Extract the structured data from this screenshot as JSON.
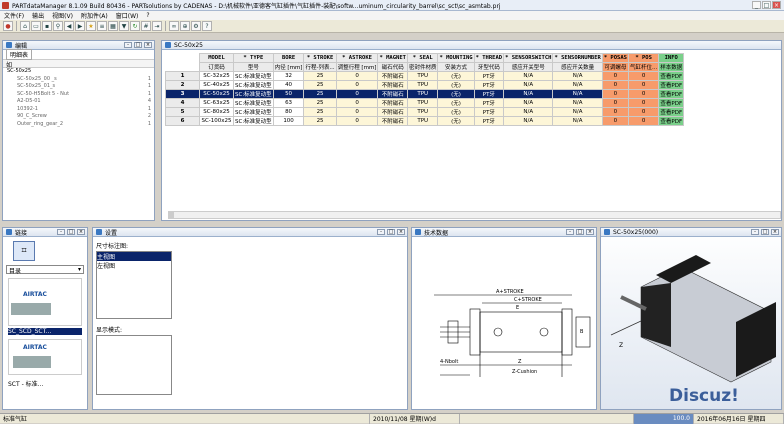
{
  "window": {
    "title": "PARTdataManager 8.1.09 Build 80436 - PARTsolutions by CADENAS - D:\\机械软件\\亚德客气缸插件\\气缸插件-装配\\softw...uminum_circularity_barrel\\sc_sct\\sc_asmtab.prj"
  },
  "menu": [
    "文件(F)",
    "输出",
    "视图(V)",
    "附加件(A)",
    "窗口(W)",
    "?"
  ],
  "left_panel": {
    "title": "编辑",
    "tab": "明细表",
    "filter_label": "如",
    "tree": [
      {
        "label": "SC-50x25",
        "count": ""
      },
      {
        "label": "SC-50x25_00 _s",
        "count": "1"
      },
      {
        "label": "SC-50x25_01_s",
        "count": "1"
      },
      {
        "label": "SC-50-H5Bolt 5 - Nut",
        "count": "1"
      },
      {
        "label": "A2-D5-01",
        "count": "4"
      },
      {
        "label": "10392-1",
        "count": "1"
      },
      {
        "label": "90_C_Screw",
        "count": "2"
      },
      {
        "label": "Outer_ring_gear_2",
        "count": "1"
      }
    ]
  },
  "table_panel": {
    "title": "SC-50x25",
    "headers": [
      {
        "key": "MODEL",
        "sub": "订货码",
        "color": "#ebebeb"
      },
      {
        "key": "* TYPE",
        "sub": "型号",
        "color": "#ebebeb"
      },
      {
        "key": "BORE",
        "sub": "内径 [mm]",
        "color": "#ebebeb"
      },
      {
        "key": "* STROKE",
        "sub": "行程-列表...",
        "color": "#ebebeb"
      },
      {
        "key": "* ASTROKE",
        "sub": "调整行程 [mm]",
        "color": "#ebebeb"
      },
      {
        "key": "* MAGNET",
        "sub": "磁石代码",
        "color": "#ebebeb"
      },
      {
        "key": "* SEAL",
        "sub": "密封件材质",
        "color": "#ebebeb"
      },
      {
        "key": "* MOUNTING",
        "sub": "安装方式",
        "color": "#ebebeb"
      },
      {
        "key": "* THREAD",
        "sub": "牙型代码",
        "color": "#ebebeb"
      },
      {
        "key": "* SENSORSWITCH",
        "sub": "感应开关型号",
        "color": "#ebebeb"
      },
      {
        "key": "* SENSORNUMBER",
        "sub": "感应开关数量",
        "color": "#ebebeb"
      },
      {
        "key": "* POSAS",
        "sub": "可调螺母",
        "color": "#f79b6b"
      },
      {
        "key": "* POS",
        "sub": "气缸杆位...",
        "color": "#f79b6b"
      },
      {
        "key": "INFO",
        "sub": "样本数据",
        "color": "#7ad08a"
      }
    ],
    "rows": [
      {
        "n": "1",
        "cells": [
          "SC-32x25",
          "SC:标准复动型",
          "32",
          "25",
          "0",
          "不附磁石",
          "TPU",
          "(无)",
          "PT牙",
          "N/A",
          "N/A",
          "0",
          "0",
          "查看PDF"
        ]
      },
      {
        "n": "2",
        "cells": [
          "SC-40x25",
          "SC:标准复动型",
          "40",
          "25",
          "0",
          "不附磁石",
          "TPU",
          "(无)",
          "PT牙",
          "N/A",
          "N/A",
          "0",
          "0",
          "查看PDF"
        ]
      },
      {
        "n": "3",
        "cells": [
          "SC-50x25",
          "SC:标准复动型",
          "50",
          "25",
          "0",
          "不附磁石",
          "TPU",
          "(无)",
          "PT牙",
          "N/A",
          "N/A",
          "0",
          "0",
          "查看PDF"
        ]
      },
      {
        "n": "4",
        "cells": [
          "SC-63x25",
          "SC:标准复动型",
          "63",
          "25",
          "0",
          "不附磁石",
          "TPU",
          "(无)",
          "PT牙",
          "N/A",
          "N/A",
          "0",
          "0",
          "查看PDF"
        ]
      },
      {
        "n": "5",
        "cells": [
          "SC-80x25",
          "SC:标准复动型",
          "80",
          "25",
          "0",
          "不附磁石",
          "TPU",
          "(无)",
          "PT牙",
          "N/A",
          "N/A",
          "0",
          "0",
          "查看PDF"
        ]
      },
      {
        "n": "6",
        "cells": [
          "SC-100x25",
          "SC:标准复动型",
          "100",
          "25",
          "0",
          "不附磁石",
          "TPU",
          "(无)",
          "PT牙",
          "N/A",
          "N/A",
          "0",
          "0",
          "查看PDF"
        ]
      }
    ],
    "selected_row": 2
  },
  "catalog_panel": {
    "title": "链接",
    "dropdown": "目录",
    "item1": "SC_SCD_SCT...",
    "item2": "SCT - 标准...",
    "brand": "AIRTAC"
  },
  "settings_panel": {
    "title": "设置",
    "label1": "尺寸标注图:",
    "options": [
      "主视图",
      "左视图"
    ],
    "label2": "显示模式:"
  },
  "drawing_panel": {
    "title": "技术数据",
    "dims": [
      "A+STROKE",
      "C+STROKE",
      "E",
      "B",
      "Z",
      "4-Nbolt",
      "Z-Cushion"
    ]
  },
  "view3d_panel": {
    "title": "SC-50x25(000)",
    "watermark": "Discuz!"
  },
  "status": {
    "left": "标准气缸",
    "date": "2010/11/08 星期(W)d",
    "value": "100.0",
    "right": "2016年06月16日 星期四"
  }
}
